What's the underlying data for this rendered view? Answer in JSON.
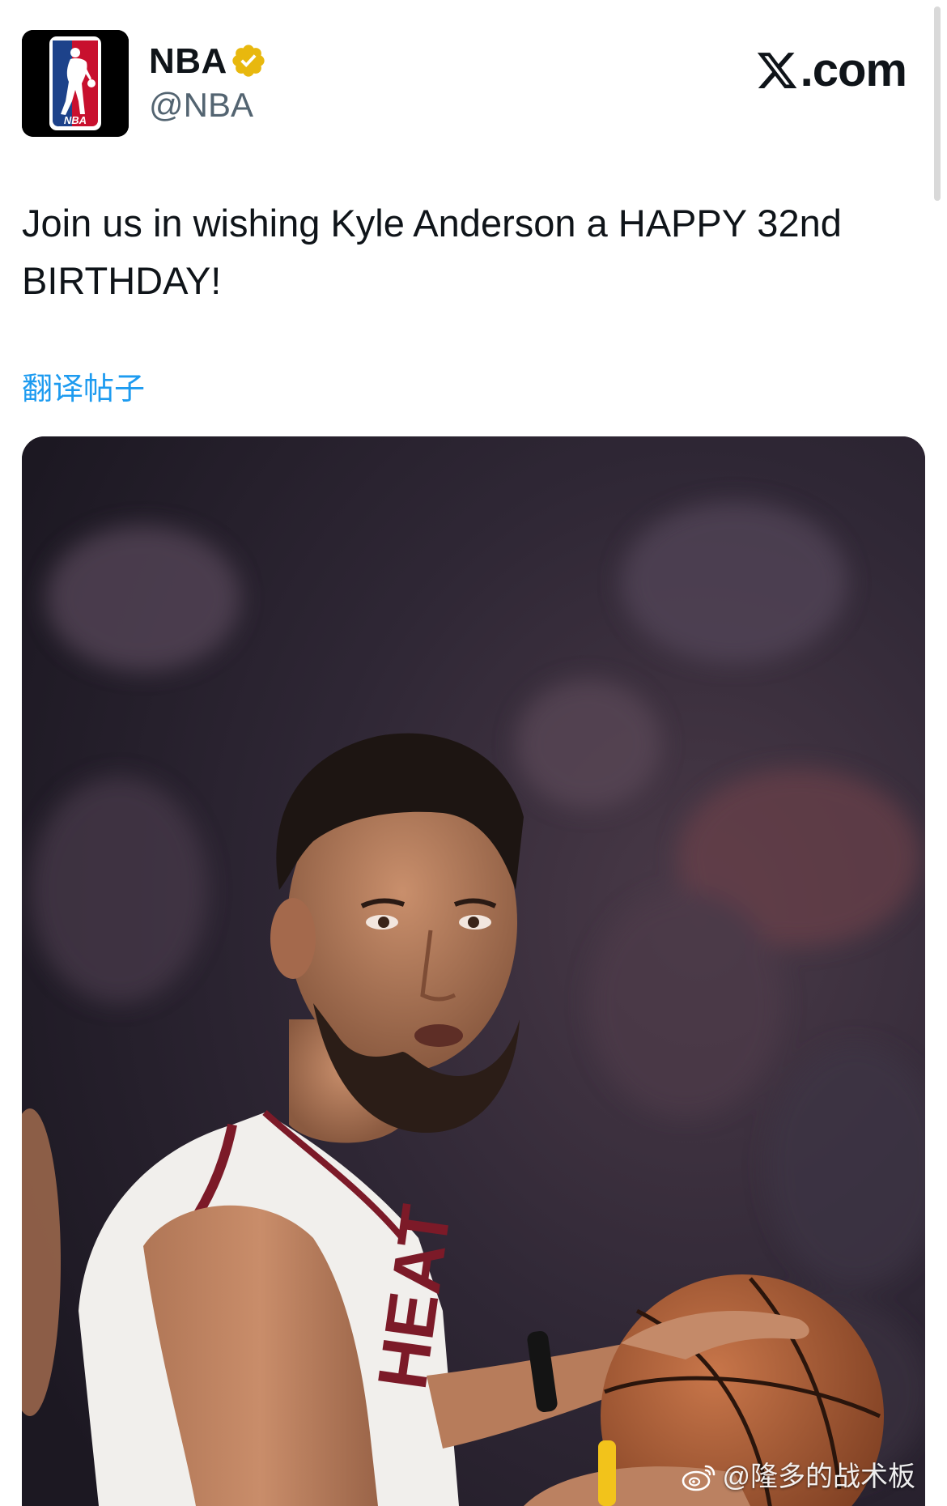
{
  "account": {
    "display_name": "NBA",
    "handle": "@NBA",
    "verified_icon": "verified-badge-icon",
    "verified_color": "#e8b80e",
    "avatar_logo_text": "NBA"
  },
  "brand": {
    "label": ".com",
    "icon": "x-logo-icon"
  },
  "tweet": {
    "text": "Join us in wishing Kyle Anderson a HAPPY 32nd BIRTHDAY!",
    "translate_label": "翻译帖子",
    "link_color": "#1d9bf0"
  },
  "media": {
    "jersey_text": "HEAT"
  },
  "watermark": {
    "text": "@隆多的战术板",
    "icon": "weibo-icon"
  }
}
